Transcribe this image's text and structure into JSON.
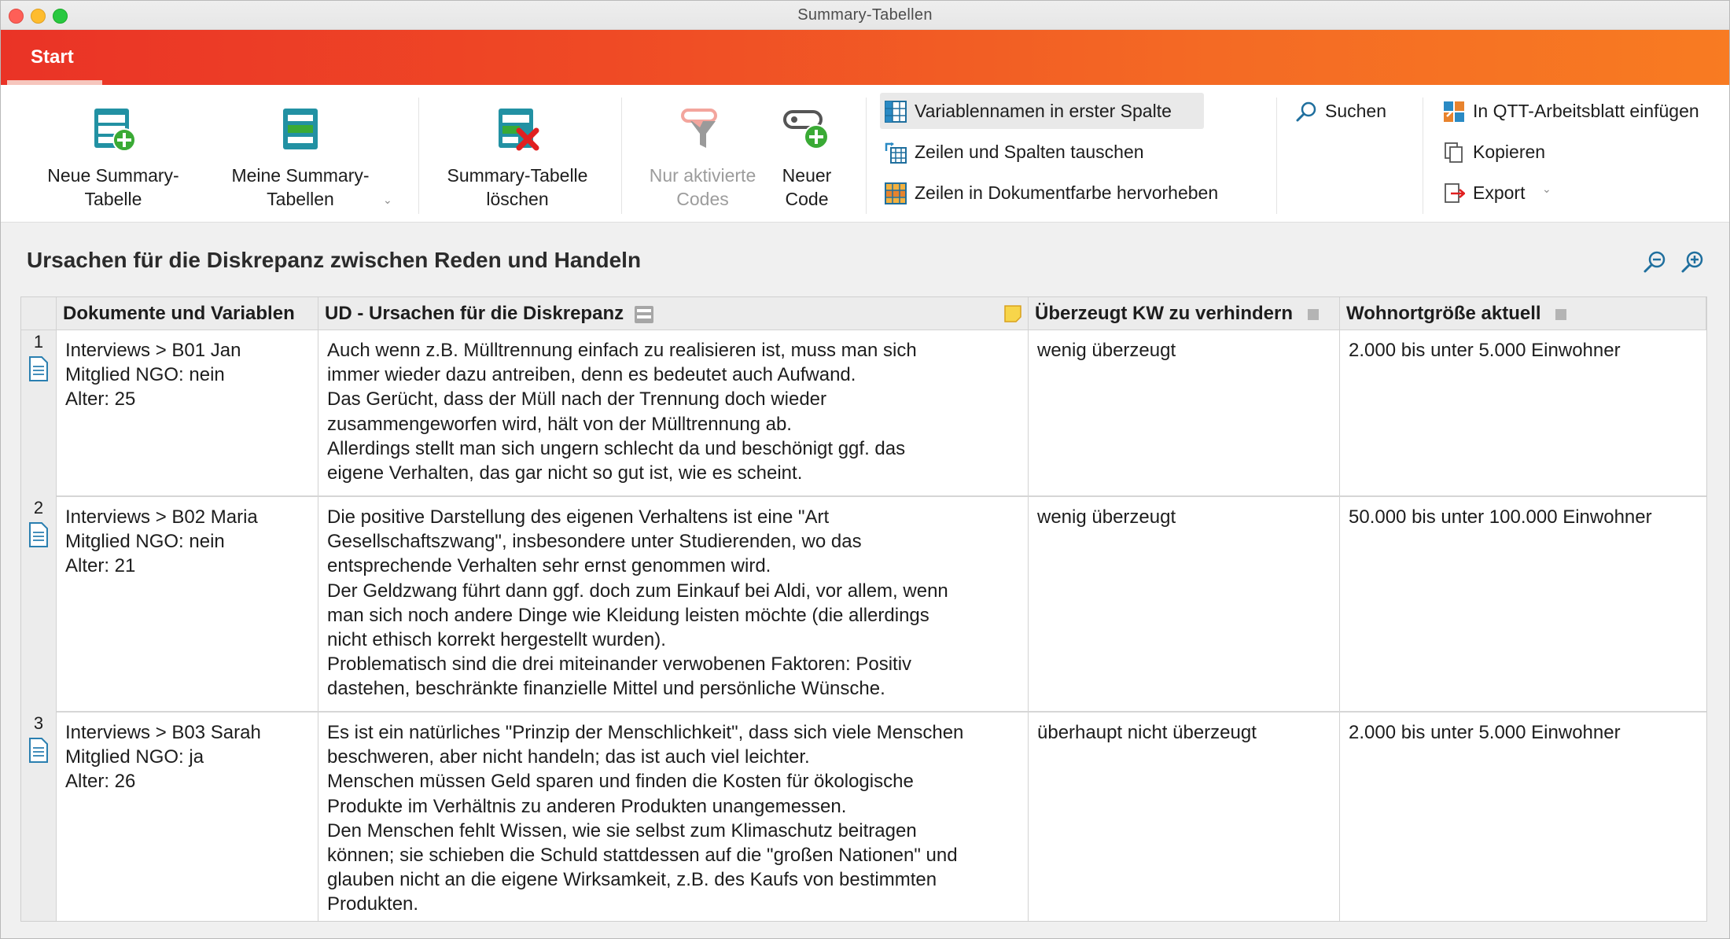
{
  "window": {
    "title": "Summary-Tabellen"
  },
  "ribbon": {
    "tab_start": "Start",
    "new_summary": "Neue Summary-\nTabelle",
    "my_summaries": "Meine Summary-\nTabellen",
    "delete_summary": "Summary-Tabelle\nlöschen",
    "only_activated": "Nur aktivierte\nCodes",
    "new_code": "Neuer\nCode",
    "var_names_first_col": "Variablennamen in erster Spalte",
    "swap_rows_cols": "Zeilen und Spalten tauschen",
    "highlight_rows": "Zeilen in Dokumentfarbe hervorheben",
    "search": "Suchen",
    "insert_qtt": "In QTT-Arbeitsblatt einfügen",
    "copy": "Kopieren",
    "export": "Export"
  },
  "table_title": "Ursachen für die Diskrepanz zwischen Reden und Handeln",
  "columns": {
    "documents": "Dokumente und Variablen",
    "ud": "UD - Ursachen für die Diskrepanz",
    "convinced": "Überzeugt KW zu verhindern",
    "town_size": "Wohnortgröße aktuell"
  },
  "rows": [
    {
      "num": "1",
      "doc": "Interviews > B01 Jan\nMitglied NGO: nein\nAlter: 25",
      "ud": "Auch wenn z.B. Mülltrennung einfach zu realisieren ist, muss man sich\nimmer wieder dazu antreiben, denn es bedeutet auch Aufwand.\nDas Gerücht, dass der Müll nach der Trennung doch wieder\nzusammengeworfen wird, hält von der Mülltrennung ab.\nAllerdings stellt man sich ungern schlecht da und beschönigt ggf. das\neigene Verhalten, das gar nicht so gut ist, wie es scheint.",
      "convinced": "wenig überzeugt",
      "town_size": "2.000 bis unter 5.000 Einwohner"
    },
    {
      "num": "2",
      "doc": "Interviews > B02 Maria\nMitglied NGO: nein\nAlter: 21",
      "ud": "Die positive Darstellung des eigenen Verhaltens ist eine \"Art\nGesellschaftszwang\", insbesondere unter Studierenden, wo das\nentsprechende Verhalten sehr ernst genommen wird.\nDer Geldzwang führt dann ggf. doch zum Einkauf bei Aldi, vor allem, wenn\nman sich noch andere Dinge wie Kleidung leisten möchte (die allerdings\nnicht ethisch korrekt hergestellt wurden).\nProblematisch sind die drei miteinander verwobenen Faktoren: Positiv\ndastehen, beschränkte finanzielle Mittel und persönliche Wünsche.",
      "convinced": "wenig überzeugt",
      "town_size": "50.000 bis unter 100.000 Einwohner"
    },
    {
      "num": "3",
      "doc": "Interviews > B03 Sarah\nMitglied NGO: ja\nAlter: 26",
      "ud": "Es ist ein natürliches \"Prinzip der Menschlichkeit\", dass sich viele Menschen\nbeschweren, aber nicht handeln; das ist auch viel leichter.\nMenschen müssen Geld sparen und finden die Kosten für ökologische\nProdukte im Verhältnis zu anderen Produkten unangemessen.\nDen Menschen fehlt Wissen, wie sie selbst zum Klimaschutz beitragen\nkönnen; sie schieben die Schuld stattdessen auf die \"großen Nationen\" und\nglauben nicht an die eigene Wirksamkeit, z.B. des Kaufs von bestimmten\nProdukten.",
      "convinced": "überhaupt nicht überzeugt",
      "town_size": "2.000 bis unter 5.000 Einwohner"
    }
  ],
  "colors": {
    "ribbon_gradient_start": "#ea3326",
    "ribbon_gradient_end": "#f87b22",
    "icon_teal": "#1f8fa0",
    "icon_green": "#3aaa35",
    "icon_red": "#e02020",
    "memo_yellow": "#f7d54a"
  }
}
